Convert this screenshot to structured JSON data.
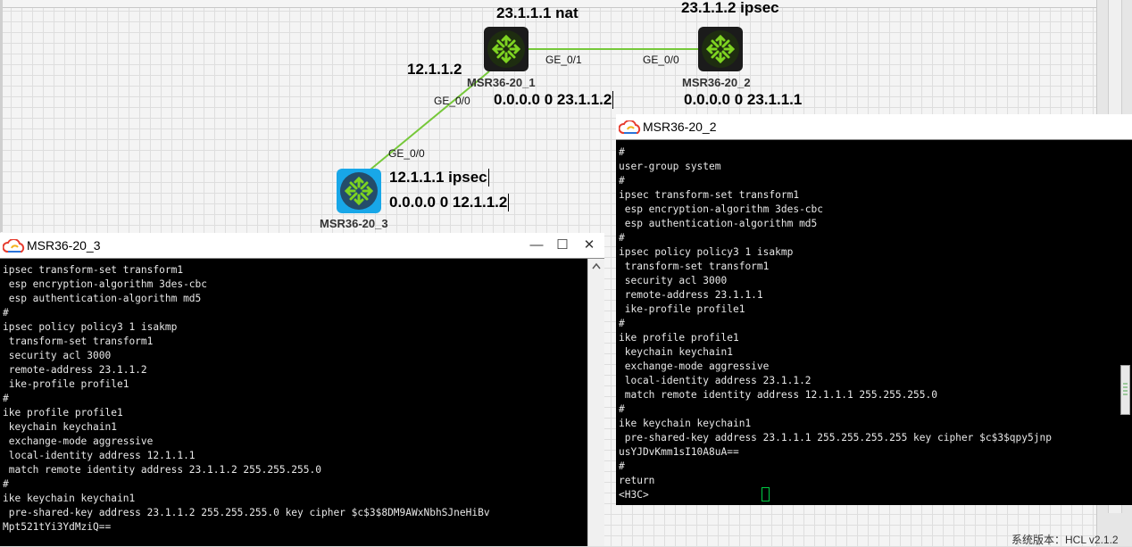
{
  "topology": {
    "nodes": [
      {
        "name": "MSR36-20_1"
      },
      {
        "name": "MSR36-20_2"
      },
      {
        "name": "MSR36-20_3"
      }
    ],
    "interfaces": {
      "r1_ge01": "GE_0/1",
      "r2_ge00": "GE_0/0",
      "r1_ge00": "GE_0/0",
      "r3_ge00": "GE_0/0"
    },
    "annotations": {
      "r1_top": "23.1.1.1 nat",
      "r2_top": "23.1.1.2 ipsec",
      "r1_left": "12.1.1.2",
      "r1_route": "0.0.0.0 0 23.1.1.2",
      "r2_route": "0.0.0.0 0 23.1.1.1",
      "r3_ipsec": "12.1.1.1 ipsec",
      "r3_route": "0.0.0.0 0 12.1.1.2"
    }
  },
  "terminal_r3": {
    "title": "MSR36-20_3",
    "window_buttons": {
      "minimize": "—",
      "maximize": "☐",
      "close": "✕"
    },
    "lines": [
      "ipsec transform-set transform1",
      " esp encryption-algorithm 3des-cbc",
      " esp authentication-algorithm md5",
      "#",
      "ipsec policy policy3 1 isakmp",
      " transform-set transform1",
      " security acl 3000",
      " remote-address 23.1.1.2",
      " ike-profile profile1",
      "#",
      "ike profile profile1",
      " keychain keychain1",
      " exchange-mode aggressive",
      " local-identity address 12.1.1.1",
      " match remote identity address 23.1.1.2 255.255.255.0",
      "#",
      "ike keychain keychain1",
      " pre-shared-key address 23.1.1.2 255.255.255.0 key cipher $c$3$8DM9AWxNbhSJneHiBv",
      "Mpt521tYi3YdMziQ=="
    ]
  },
  "terminal_r2": {
    "title": "MSR36-20_2",
    "lines": [
      "#",
      "user-group system",
      "#",
      "ipsec transform-set transform1",
      " esp encryption-algorithm 3des-cbc",
      " esp authentication-algorithm md5",
      "#",
      "ipsec policy policy3 1 isakmp",
      " transform-set transform1",
      " security acl 3000",
      " remote-address 23.1.1.1",
      " ike-profile profile1",
      "#",
      "ike profile profile1",
      " keychain keychain1",
      " exchange-mode aggressive",
      " local-identity address 23.1.1.2",
      " match remote identity address 12.1.1.1 255.255.255.0",
      "#",
      "ike keychain keychain1",
      " pre-shared-key address 23.1.1.1 255.255.255.255 key cipher $c$3$qpy5jnp",
      "usYJDvKmm1sI10A8uA==",
      "#",
      "return",
      "<H3C>"
    ]
  },
  "status_bar": {
    "version": "系统版本：HCL v2.1.2"
  },
  "colors": {
    "link": "#76c83a",
    "router_icon": "#7ed321",
    "cursor": "#00cc44"
  },
  "icons": [
    "router-icon",
    "hcl-cloud-icon",
    "minimize-icon",
    "maximize-icon",
    "close-icon"
  ]
}
